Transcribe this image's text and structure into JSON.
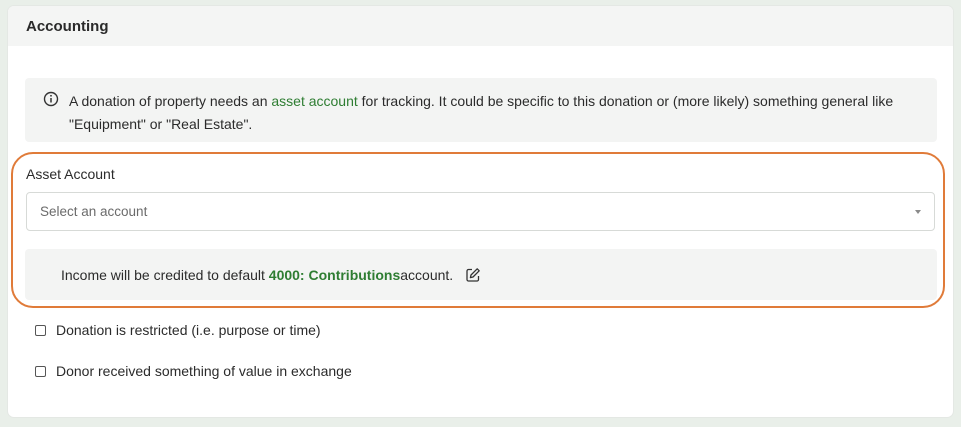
{
  "card": {
    "title": "Accounting"
  },
  "info": {
    "icon": "info-circle-icon",
    "text_before": "A donation of property needs an ",
    "link": "asset account",
    "text_after": " for tracking. It could be specific to this donation or (more likely) something general like \"Equipment\" or \"Real Estate\"."
  },
  "asset_account": {
    "label": "Asset Account",
    "placeholder": "Select an account"
  },
  "income": {
    "text_before": "Income will be credited to default ",
    "account": "4000: Contributions",
    "text_after": " account.",
    "edit_icon": "edit-icon"
  },
  "options": {
    "restricted": {
      "label": "Donation is restricted (i.e. purpose or time)",
      "checked": false
    },
    "exchange": {
      "label": "Donor received something of value in exchange",
      "checked": false
    }
  },
  "colors": {
    "accent_green": "#2e7d32",
    "highlight_orange": "#e07b39"
  }
}
